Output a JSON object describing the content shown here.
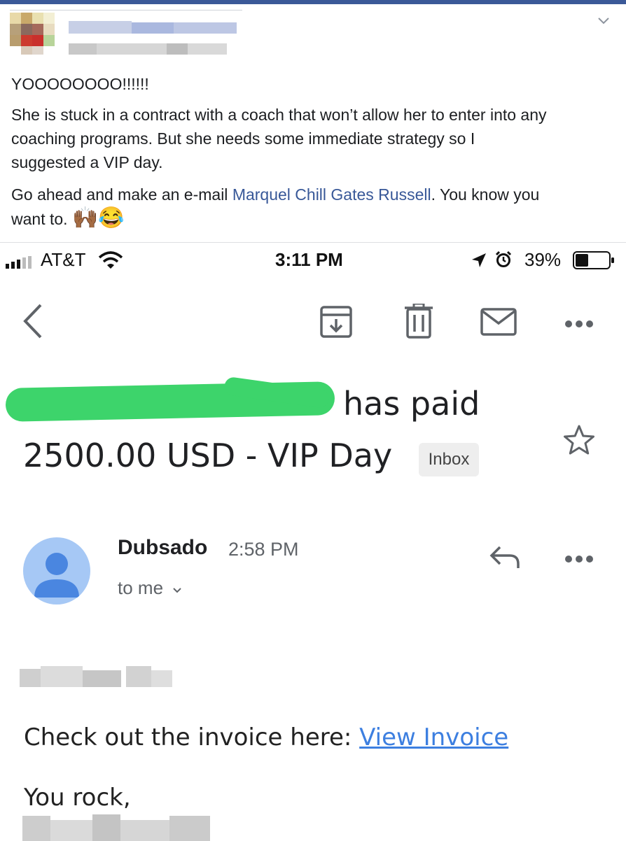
{
  "post": {
    "headline": "YOOOOOOOO!!!!!!",
    "paragraph1_line1": "She is stuck in a contract with a coach that won’t allow her to enter into any",
    "paragraph1_line2": "coaching programs. But she needs some immediate strategy so I",
    "paragraph1_line3": "suggested a VIP day.",
    "paragraph2_prefix": "Go ahead and make an e-mail ",
    "paragraph2_mention": "Marquel Chill Gates Russell",
    "paragraph2_suffix": ". You know you",
    "paragraph2_line2": "want to.",
    "emoji": "🙌🏾😂"
  },
  "phone": {
    "carrier": "AT&T",
    "time": "3:11 PM",
    "battery": "39%",
    "battery_level": 0.39
  },
  "email": {
    "subject_line1_visible": "has paid",
    "subject_line2": "2500.00 USD - VIP Day",
    "inbox_label": "Inbox",
    "sender": "Dubsado",
    "sent_time": "2:58 PM",
    "recipient": "to me",
    "body_line": "Check out the invoice here: ",
    "invoice_link": "View Invoice",
    "closing": "You rock,"
  },
  "icons": {
    "back": "chevron-left-icon",
    "archive": "archive-icon",
    "delete": "trash-icon",
    "mark_unread": "mail-icon",
    "more": "more-icon",
    "star": "star-icon",
    "reply": "reply-icon"
  },
  "colors": {
    "facebook_blue": "#3b5998",
    "mention_link": "#385898",
    "redaction_green": "#3dd46b",
    "gmail_link": "#3d7fe0",
    "avatar_bg": "#a6c8f5",
    "avatar_fg": "#4a86e0"
  }
}
